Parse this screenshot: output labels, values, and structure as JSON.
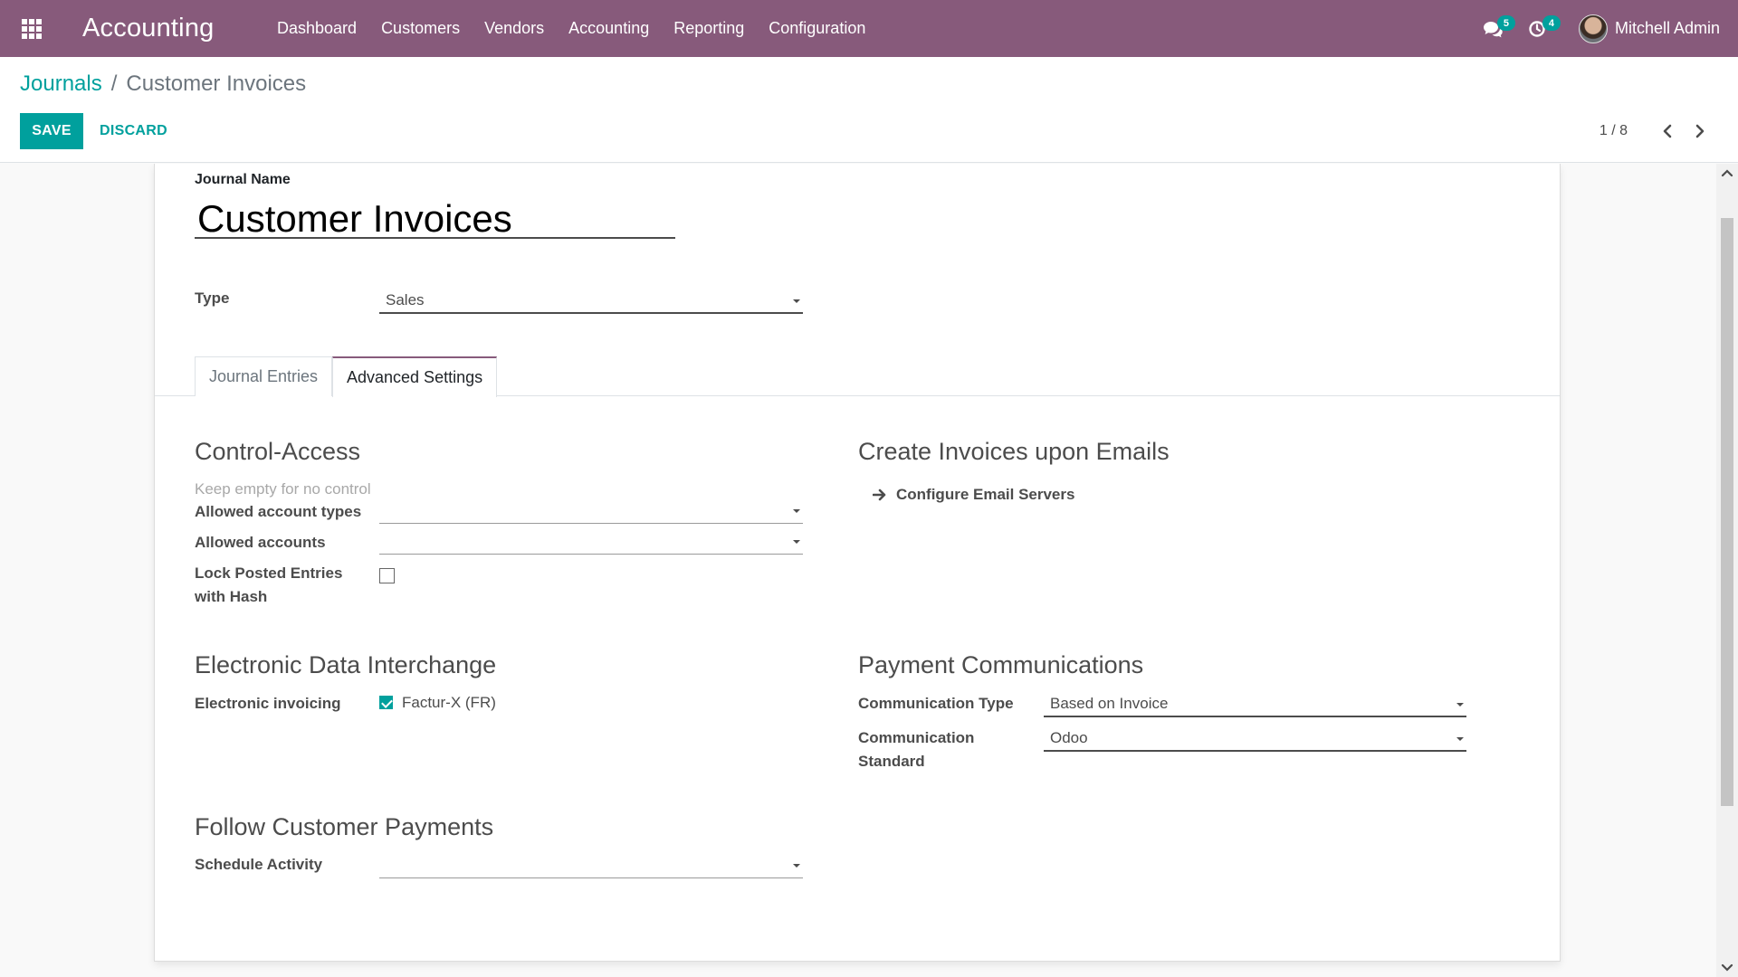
{
  "navbar": {
    "apps_icon": "apps-grid-icon",
    "brand": "Accounting",
    "menu": [
      "Dashboard",
      "Customers",
      "Vendors",
      "Accounting",
      "Reporting",
      "Configuration"
    ],
    "messages_count": "5",
    "activities_count": "4",
    "user_name": "Mitchell Admin"
  },
  "control_panel": {
    "breadcrumb_parent": "Journals",
    "breadcrumb_separator": "/",
    "breadcrumb_current": "Customer Invoices",
    "save_label": "SAVE",
    "discard_label": "DISCARD",
    "pager_value": "1 / 8"
  },
  "form": {
    "journal_name_label": "Journal Name",
    "journal_name": "Customer Invoices",
    "type_label": "Type",
    "type_value": "Sales",
    "tabs": [
      "Journal Entries",
      "Advanced Settings"
    ],
    "active_tab": "Advanced Settings",
    "control_access": {
      "title": "Control-Access",
      "hint": "Keep empty for no control",
      "allowed_account_types_label": "Allowed account types",
      "allowed_account_types_value": "",
      "allowed_accounts_label": "Allowed accounts",
      "allowed_accounts_value": "",
      "lock_posted_label_line1": "Lock Posted Entries",
      "lock_posted_label_line2": "with Hash",
      "lock_posted_checked": false
    },
    "create_invoices": {
      "title": "Create Invoices upon Emails",
      "configure_link": "Configure Email Servers"
    },
    "edi": {
      "title": "Electronic Data Interchange",
      "electronic_invoicing_label": "Electronic invoicing",
      "facturx_label": "Factur-X (FR)",
      "facturx_checked": true
    },
    "payment_communications": {
      "title": "Payment Communications",
      "communication_type_label": "Communication Type",
      "communication_type_value": "Based on Invoice",
      "communication_standard_label_line1": "Communication",
      "communication_standard_label_line2": "Standard",
      "communication_standard_value": "Odoo"
    },
    "follow_payments": {
      "title": "Follow Customer Payments",
      "schedule_activity_label": "Schedule Activity",
      "schedule_activity_value": ""
    }
  },
  "colors": {
    "navbar": "#875a7b",
    "accent": "#00a09d"
  }
}
